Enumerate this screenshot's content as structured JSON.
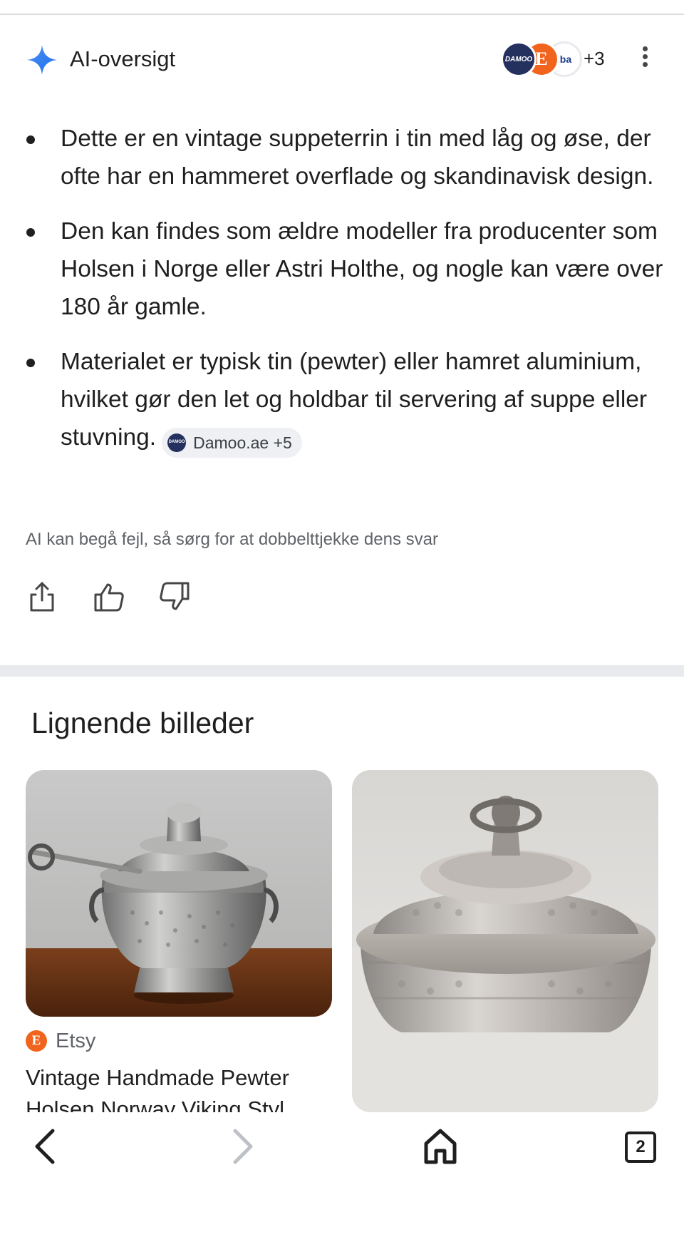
{
  "ai_overview": {
    "title": "AI-oversigt",
    "sources": {
      "chips": [
        {
          "name": "Damoo",
          "icon": "damoo-logo",
          "color": "#24305e",
          "text": "DAMOO"
        },
        {
          "name": "Etsy",
          "icon": "etsy-logo",
          "color": "#f1641e",
          "text": "E"
        },
        {
          "name": "Iba",
          "icon": "iba-logo",
          "color": "#1a3a8a",
          "text": "Iba"
        }
      ],
      "more_count": "+3"
    },
    "menu_icon": "more-vert-icon",
    "bullets": [
      {
        "text": "Dette er en vintage suppeterrin i tin med låg og øse, der ofte har en hammeret overflade og skandinavisk design."
      },
      {
        "text": "Den kan findes som ældre modeller fra producenter som Holsen i Norge eller Astri Holthe, og nogle kan være over 180 år gamle."
      },
      {
        "text": "Materialet er typisk tin (pewter) eller hamret aluminium, hvilket gør den let og holdbar til servering af suppe eller stuvning."
      }
    ],
    "citation": {
      "label": "Damoo.ae +5",
      "logo_text": "DAMOO"
    },
    "disclaimer": "AI kan begå fejl, så sørg for at dobbelttjekke dens svar",
    "feedback_icons": [
      "share-icon",
      "thumbs-up-icon",
      "thumbs-down-icon"
    ]
  },
  "similar_images": {
    "title": "Lignende billeder",
    "cards": [
      {
        "source": "Etsy",
        "source_icon_text": "E",
        "title": "Vintage Handmade Pewter Holsen Norway Viking Styl"
      },
      {
        "source": "",
        "title": ""
      }
    ]
  },
  "bottom_nav": {
    "back_icon": "back-arrow-icon",
    "forward_icon": "forward-arrow-icon",
    "home_icon": "home-icon",
    "tabs_count": "2"
  },
  "colors": {
    "accent_blue": "#4285f4",
    "etsy_orange": "#f1641e",
    "damoo_navy": "#24305e",
    "muted_text": "#5f6368",
    "separator": "#e8eaed"
  }
}
